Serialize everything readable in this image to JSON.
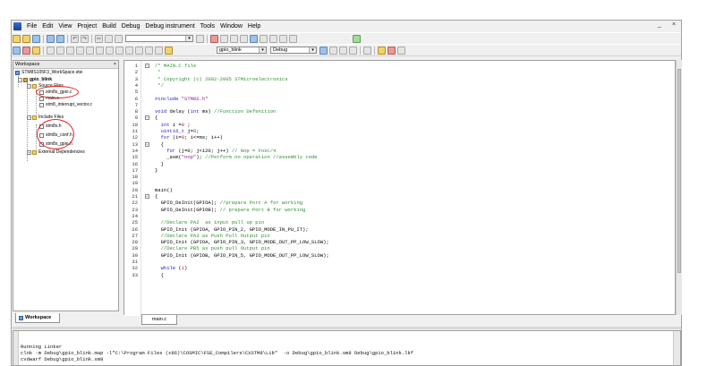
{
  "menubar": {
    "items": [
      "File",
      "Edit",
      "View",
      "Project",
      "Build",
      "Debug",
      "Debug instrument",
      "Tools",
      "Window",
      "Help"
    ],
    "window_controls": [
      "_",
      "×"
    ]
  },
  "toolbar2": {
    "project_combo": "gpio_blink",
    "config_combo": "Debug"
  },
  "workspace": {
    "title": "Workspace",
    "close": "×",
    "tab_label": "Workspace",
    "tree": [
      {
        "label": "STM8S105F3_WorkSpace.stw",
        "kind": "ws"
      },
      {
        "label": "gpio_blink",
        "kind": "proj"
      },
      {
        "label": "Source Files",
        "kind": "folder"
      },
      {
        "label": "stm8s_gpio.c",
        "kind": "file"
      },
      {
        "label": "main.c",
        "kind": "file"
      },
      {
        "label": "stm8_interrupt_vector.c",
        "kind": "file"
      },
      {
        "label": "Include Files",
        "kind": "folder"
      },
      {
        "label": "stm8s.h",
        "kind": "file"
      },
      {
        "label": "stm8s_conf.h",
        "kind": "file"
      },
      {
        "label": "stm8s_gpio.h",
        "kind": "file"
      },
      {
        "label": "External Dependencies",
        "kind": "folder"
      }
    ]
  },
  "editor": {
    "tab_label": "main.c",
    "lines": [
      {
        "n": "1",
        "t": "/* MAIN.C file",
        "c": "com"
      },
      {
        "n": "2",
        "t": " *",
        "c": "com"
      },
      {
        "n": "3",
        "t": " * Copyright (c) 2002-2005 STMicroelectronics",
        "c": "com"
      },
      {
        "n": "4",
        "t": " */",
        "c": "com"
      },
      {
        "n": "5",
        "t": "",
        "c": "txt"
      },
      {
        "n": "6",
        "t": "#include \"STM8S.h\"",
        "c": "pp"
      },
      {
        "n": "7",
        "t": "",
        "c": "txt"
      },
      {
        "n": "8",
        "t": "void delay (int ms) //Function Defenition",
        "c": "mix1"
      },
      {
        "n": "9",
        "t": "{",
        "c": "txt"
      },
      {
        "n": "10",
        "t": "  int i =0 ;",
        "c": "kw"
      },
      {
        "n": "11",
        "t": "  uint16_t j=0;",
        "c": "kw"
      },
      {
        "n": "12",
        "t": "  for (i=0; i<=ms; i++)",
        "c": "kw"
      },
      {
        "n": "13",
        "t": "  {",
        "c": "txt"
      },
      {
        "n": "14",
        "t": "    for (j=0; j<120; j++) // Nop = Fosc/4",
        "c": "mix2"
      },
      {
        "n": "15",
        "t": "    _asm(\"nop\"); //Perform no operation //assembly code",
        "c": "mix3"
      },
      {
        "n": "16",
        "t": "  }",
        "c": "txt"
      },
      {
        "n": "17",
        "t": "}",
        "c": "txt"
      },
      {
        "n": "18",
        "t": "",
        "c": "txt"
      },
      {
        "n": "19",
        "t": "",
        "c": "txt"
      },
      {
        "n": "20",
        "t": "main()",
        "c": "txt"
      },
      {
        "n": "21",
        "t": "{",
        "c": "txt"
      },
      {
        "n": "22",
        "t": "  GPIO_DeInit(GPIOA); //prepare Port A for working",
        "c": "mix4"
      },
      {
        "n": "23",
        "t": "  GPIO_DeInit(GPIOB); // prepare Port B for working",
        "c": "mix5"
      },
      {
        "n": "24",
        "t": "",
        "c": "txt"
      },
      {
        "n": "25",
        "t": "  //Declare PA2  as input pull up pin",
        "c": "com"
      },
      {
        "n": "26",
        "t": "  GPIO_Init (GPIOA, GPIO_PIN_2, GPIO_MODE_IN_PU_IT);",
        "c": "txt"
      },
      {
        "n": "27",
        "t": "  //Declare PA3 as Push Pull Output pin",
        "c": "com"
      },
      {
        "n": "28",
        "t": "  GPIO_Init (GPIOA, GPIO_PIN_3, GPIO_MODE_OUT_PP_LOW_SLOW);",
        "c": "txt"
      },
      {
        "n": "29",
        "t": "  //Declare PB5 as push pull Output pin",
        "c": "com"
      },
      {
        "n": "30",
        "t": "  GPIO_Init (GPIOB, GPIO_PIN_5, GPIO_MODE_OUT_PP_LOW_SLOW);",
        "c": "txt"
      },
      {
        "n": "31",
        "t": "",
        "c": "txt"
      },
      {
        "n": "32",
        "t": "  while (1)",
        "c": "kw2"
      },
      {
        "n": "33",
        "t": "  {",
        "c": "txt"
      }
    ]
  },
  "output": {
    "lines": [
      "Running Linker",
      "clnk -m Debug\\gpio_blink.map -l\"C:\\Program Files (x86)\\COSMIC\\FSE_Compilers\\CXSTM8\\Lib\"  -o Debug\\gpio_blink.sm8 Debug\\gpio_blink.lkf",
      "cvdwarf Debug\\gpio_blink.sm8"
    ]
  }
}
